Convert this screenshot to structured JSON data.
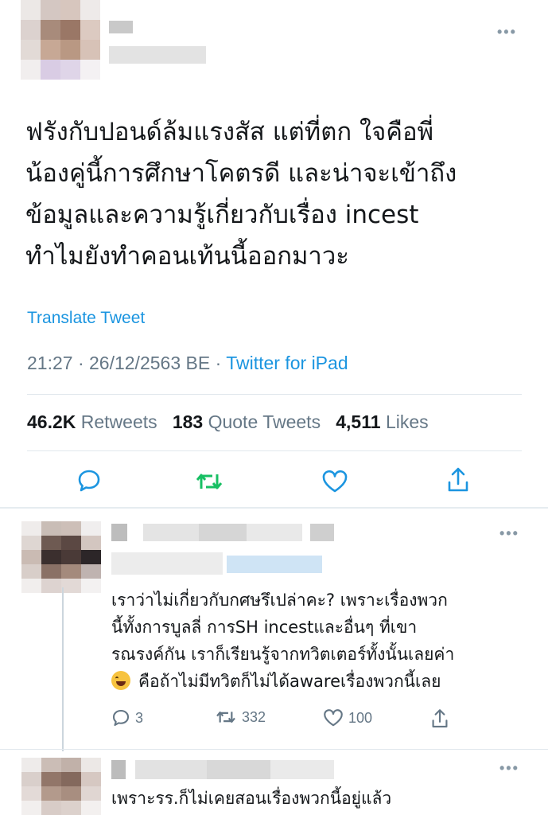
{
  "main_tweet": {
    "text_lines": [
      "ฟรังกับปอนด์ล้มแรงสัส แต่ที่ตก ใจคือพี่",
      "น้องคู่นี้การศึกษาโคตรดี และน่าจะเข้าถึง",
      "ข้อมูลและความรู้เกี่ยวกับเรื่อง incest",
      "ทำไมยังทำคอนเท้นนี้ออกมาวะ"
    ],
    "translate_label": "Translate Tweet",
    "timestamp": "21:27 · 26/12/2563 BE",
    "separator": " · ",
    "source": "Twitter for iPad",
    "retweets_count": "46.2K",
    "retweets_label": "Retweets",
    "quotes_count": "183",
    "quotes_label": "Quote Tweets",
    "likes_count": "4,511",
    "likes_label": "Likes",
    "more_label": "•••"
  },
  "replies": [
    {
      "text_lines": [
        "เราว่าไม่เกี่ยวกับกศษรึเปล่าคะ? เพราะเรื่องพวก",
        "นี้ทั้งการบูลลี่ การSH incestและอื่นๆ ที่เขา",
        "รณรงค์กัน เราก็เรียนรู้จากทวิตเตอร์ทั้งนั้นเลยค่า",
        "คือถ้าไม่มีทวิตก็ไม่ได้awareเรื่องพวกนี้เลย"
      ],
      "reply_count": "3",
      "retweet_count": "332",
      "like_count": "100",
      "more_label": "•••"
    },
    {
      "text_lines": [
        "เพราะรร.ก็ไม่เคยสอนเรื่องพวกนี้อยู่แล้ว"
      ],
      "more_label": "•••"
    }
  ],
  "colors": {
    "accent": "#1b95e0",
    "retweet_green": "#17bf63",
    "muted": "#657786",
    "divider": "#e1e8ed"
  }
}
